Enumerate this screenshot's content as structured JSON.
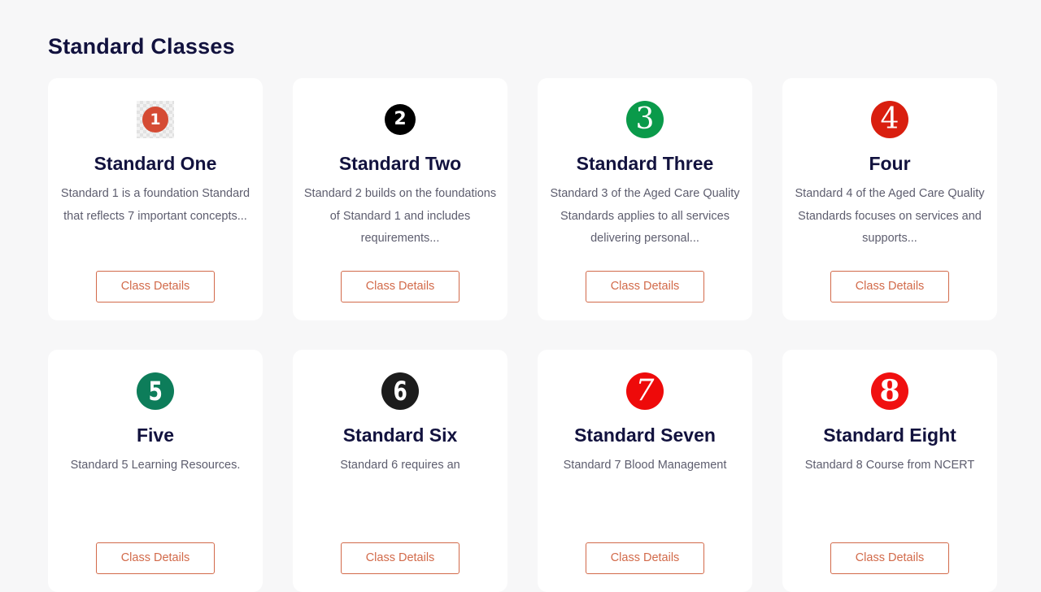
{
  "page": {
    "title": "Standard Classes"
  },
  "colors": {
    "title": "#12123e",
    "button_accent": "#d26a4a",
    "body_text": "#5d5d6e",
    "background": "#f7f7f8"
  },
  "cards": [
    {
      "number": "1",
      "icon": "number-1-icon",
      "icon_color": "#d54b34",
      "title": "Standard One",
      "description": "Standard 1 is a foundation Standard that reflects 7 important concepts...",
      "button_label": "Class Details"
    },
    {
      "number": "2",
      "icon": "number-2-icon",
      "icon_color": "#000000",
      "title": "Standard Two",
      "description": "Standard 2 builds on the foundations of Standard 1 and includes requirements...",
      "button_label": "Class Details"
    },
    {
      "number": "3",
      "icon": "number-3-icon",
      "icon_color": "#0a9a4a",
      "title": "Standard Three",
      "description": "Standard 3 of the Aged Care Quality Standards applies to all services delivering personal...",
      "button_label": "Class Details"
    },
    {
      "number": "4",
      "icon": "number-4-icon",
      "icon_color": "#d91f0f",
      "title": "Four",
      "description": "Standard 4 of the Aged Care Quality Standards focuses on services and supports...",
      "button_label": "Class Details"
    },
    {
      "number": "5",
      "icon": "number-5-icon",
      "icon_color": "#0d7d5a",
      "title": "Five",
      "description": "Standard 5 Learning Resources.",
      "button_label": "Class Details"
    },
    {
      "number": "6",
      "icon": "number-6-icon",
      "icon_color": "#1c1c1c",
      "title": "Standard Six",
      "description": "Standard 6 requires an",
      "button_label": "Class Details"
    },
    {
      "number": "7",
      "icon": "number-7-icon",
      "icon_color": "#ee0a0a",
      "title": "Standard Seven",
      "description": "Standard 7 Blood Management",
      "button_label": "Class Details"
    },
    {
      "number": "8",
      "icon": "number-8-icon",
      "icon_color": "#f01010",
      "title": "Standard Eight",
      "description": "Standard 8 Course from NCERT",
      "button_label": "Class Details"
    }
  ]
}
